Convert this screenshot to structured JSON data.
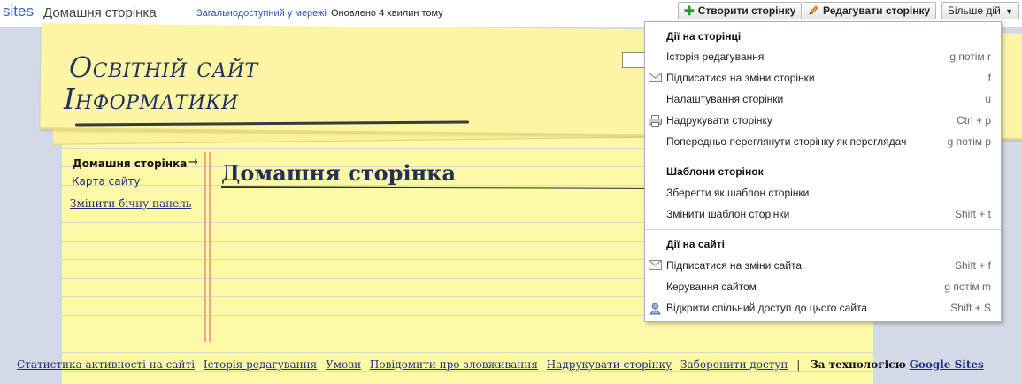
{
  "topbar": {
    "logo": "sites",
    "page_title": "Домашня сторінка",
    "sharing_status": "Загальнодоступний у мережі",
    "updated_status": "Оновлено 4 хвилин тому",
    "create_page_label": "Створити сторінку",
    "edit_page_label": "Редагувати сторінку",
    "more_actions_label": "Більше дій"
  },
  "site": {
    "title_line1": "Освітній сайт",
    "title_line2": "Інформатики"
  },
  "sidebar": {
    "items": [
      {
        "label": "Домашня сторінка"
      },
      {
        "label": "Карта сайту"
      }
    ],
    "edit_label": "Змінити бічну панель"
  },
  "main": {
    "heading": "Домашня сторінка"
  },
  "menu": {
    "sections": [
      {
        "title": "Дії на сторінці",
        "items": [
          {
            "label": "Історія редагування",
            "shortcut": "g потім r",
            "icon": ""
          },
          {
            "label": "Підписатися на зміни сторінки",
            "shortcut": "f",
            "icon": "envelope-icon"
          },
          {
            "label": "Налаштування сторінки",
            "shortcut": "u",
            "icon": ""
          },
          {
            "label": "Надрукувати сторінку",
            "shortcut": "Ctrl + p",
            "icon": "printer-icon"
          },
          {
            "label": "Попередньо переглянути сторінку як переглядач",
            "shortcut": "g потім p",
            "icon": ""
          }
        ]
      },
      {
        "title": "Шаблони сторінок",
        "items": [
          {
            "label": "Зберегти як шаблон сторінки",
            "shortcut": "",
            "icon": ""
          },
          {
            "label": "Змінити шаблон сторінки",
            "shortcut": "Shift + t",
            "icon": ""
          }
        ]
      },
      {
        "title": "Дії на сайті",
        "items": [
          {
            "label": "Підписатися на зміни сайта",
            "shortcut": "Shift + f",
            "icon": "envelope-icon"
          },
          {
            "label": "Керування сайтом",
            "shortcut": "g потім m",
            "icon": ""
          },
          {
            "label": "Відкрити спільний доступ до цього сайта",
            "shortcut": "Shift + S",
            "icon": "share-user-icon"
          }
        ]
      }
    ]
  },
  "footer": {
    "links": [
      "Статистика активності на сайті",
      "Історія редагування",
      "Умови",
      "Повідомити про зловживання",
      "Надрукувати сторінку",
      "Заборонити доступ"
    ],
    "separator": "|",
    "powered_prefix": "За технологією",
    "powered_link": "Google Sites"
  },
  "colors": {
    "paper": "#fdf9a6",
    "title_ink": "#22305e",
    "link": "#22307a",
    "margin_line": "#f1a58f"
  }
}
